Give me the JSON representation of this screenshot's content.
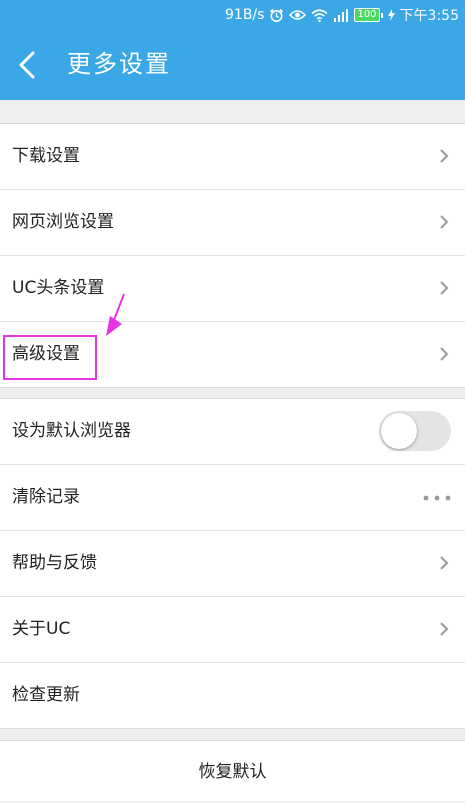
{
  "status_bar": {
    "speed": "91B/s",
    "battery": "100",
    "time": "下午3:55"
  },
  "header": {
    "title": "更多设置"
  },
  "section1": {
    "items": [
      {
        "label": "下载设置"
      },
      {
        "label": "网页浏览设置"
      },
      {
        "label": "UC头条设置"
      },
      {
        "label": "高级设置"
      }
    ]
  },
  "section2": {
    "items": [
      {
        "label": "设为默认浏览器",
        "control": "toggle",
        "toggle_on": false
      },
      {
        "label": "清除记录",
        "control": "more-dots"
      },
      {
        "label": "帮助与反馈",
        "control": "chevron"
      },
      {
        "label": "关于UC",
        "control": "chevron"
      },
      {
        "label": "检查更新",
        "control": "none"
      }
    ]
  },
  "footer": {
    "restore_label": "恢复默认"
  },
  "colors": {
    "primary": "#3aa7e6",
    "highlight": "#e535e5",
    "battery": "#4cd964"
  }
}
